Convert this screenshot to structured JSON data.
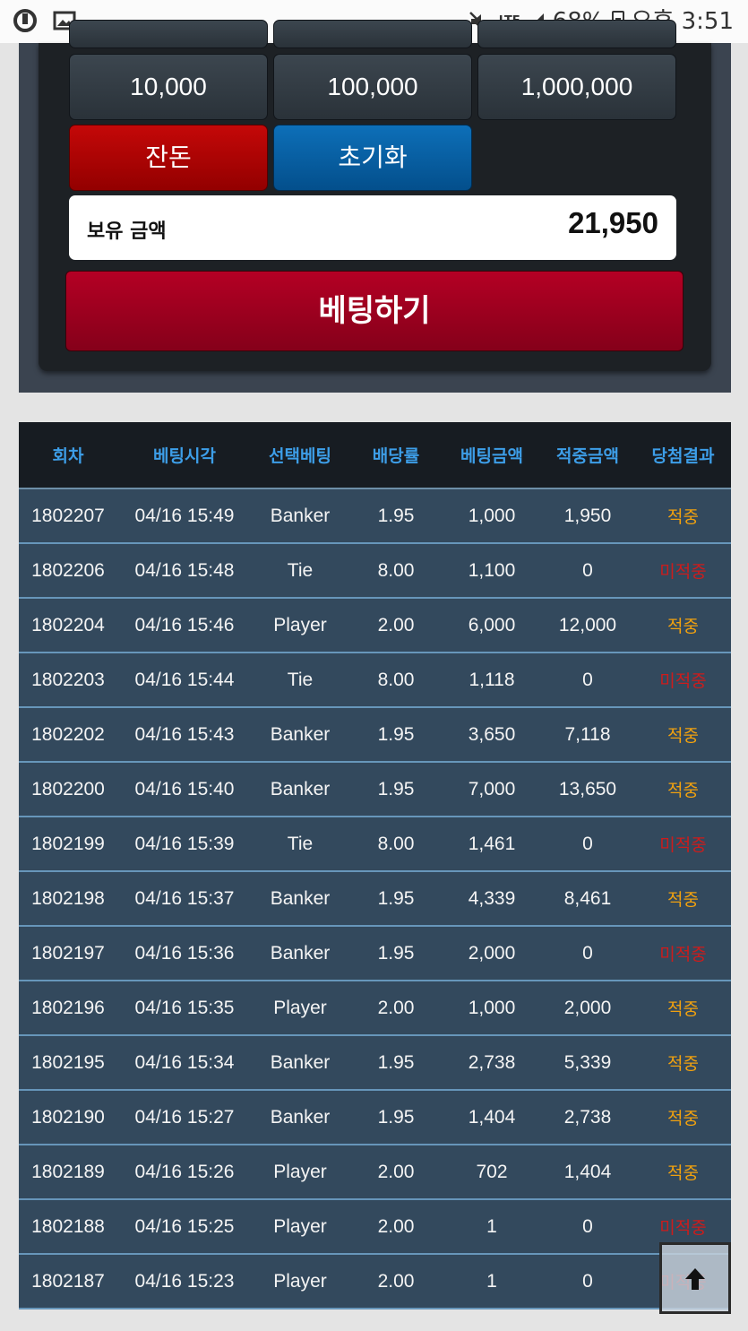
{
  "status_bar": {
    "battery": "68%",
    "time": "오후 3:51",
    "network": "LTE"
  },
  "chips": {
    "row1": [
      "10,000",
      "100,000",
      "1,000,000"
    ]
  },
  "buttons": {
    "change": "잔돈",
    "reset": "초기화",
    "bet": "베팅하기"
  },
  "balance": {
    "label": "보유 금액",
    "value": "21,950"
  },
  "table": {
    "headers": [
      "회차",
      "베팅시각",
      "선택베팅",
      "배당률",
      "베팅금액",
      "적중금액",
      "당첨결과"
    ],
    "rows": [
      {
        "round": "1802207",
        "time": "04/16 15:49",
        "pick": "Banker",
        "odds": "1.95",
        "bet": "1,000",
        "win": "1,950",
        "result": "적중"
      },
      {
        "round": "1802206",
        "time": "04/16 15:48",
        "pick": "Tie",
        "odds": "8.00",
        "bet": "1,100",
        "win": "0",
        "result": "미적중"
      },
      {
        "round": "1802204",
        "time": "04/16 15:46",
        "pick": "Player",
        "odds": "2.00",
        "bet": "6,000",
        "win": "12,000",
        "result": "적중"
      },
      {
        "round": "1802203",
        "time": "04/16 15:44",
        "pick": "Tie",
        "odds": "8.00",
        "bet": "1,118",
        "win": "0",
        "result": "미적중"
      },
      {
        "round": "1802202",
        "time": "04/16 15:43",
        "pick": "Banker",
        "odds": "1.95",
        "bet": "3,650",
        "win": "7,118",
        "result": "적중"
      },
      {
        "round": "1802200",
        "time": "04/16 15:40",
        "pick": "Banker",
        "odds": "1.95",
        "bet": "7,000",
        "win": "13,650",
        "result": "적중"
      },
      {
        "round": "1802199",
        "time": "04/16 15:39",
        "pick": "Tie",
        "odds": "8.00",
        "bet": "1,461",
        "win": "0",
        "result": "미적중"
      },
      {
        "round": "1802198",
        "time": "04/16 15:37",
        "pick": "Banker",
        "odds": "1.95",
        "bet": "4,339",
        "win": "8,461",
        "result": "적중"
      },
      {
        "round": "1802197",
        "time": "04/16 15:36",
        "pick": "Banker",
        "odds": "1.95",
        "bet": "2,000",
        "win": "0",
        "result": "미적중"
      },
      {
        "round": "1802196",
        "time": "04/16 15:35",
        "pick": "Player",
        "odds": "2.00",
        "bet": "1,000",
        "win": "2,000",
        "result": "적중"
      },
      {
        "round": "1802195",
        "time": "04/16 15:34",
        "pick": "Banker",
        "odds": "1.95",
        "bet": "2,738",
        "win": "5,339",
        "result": "적중"
      },
      {
        "round": "1802190",
        "time": "04/16 15:27",
        "pick": "Banker",
        "odds": "1.95",
        "bet": "1,404",
        "win": "2,738",
        "result": "적중"
      },
      {
        "round": "1802189",
        "time": "04/16 15:26",
        "pick": "Player",
        "odds": "2.00",
        "bet": "702",
        "win": "1,404",
        "result": "적중"
      },
      {
        "round": "1802188",
        "time": "04/16 15:25",
        "pick": "Player",
        "odds": "2.00",
        "bet": "1",
        "win": "0",
        "result": "미적중"
      },
      {
        "round": "1802187",
        "time": "04/16 15:23",
        "pick": "Player",
        "odds": "2.00",
        "bet": "1",
        "win": "0",
        "result": "미적중"
      }
    ]
  },
  "colors": {
    "hit": "#f0a10f",
    "miss": "#cc1c1c",
    "header_text": "#3d9ee8"
  }
}
